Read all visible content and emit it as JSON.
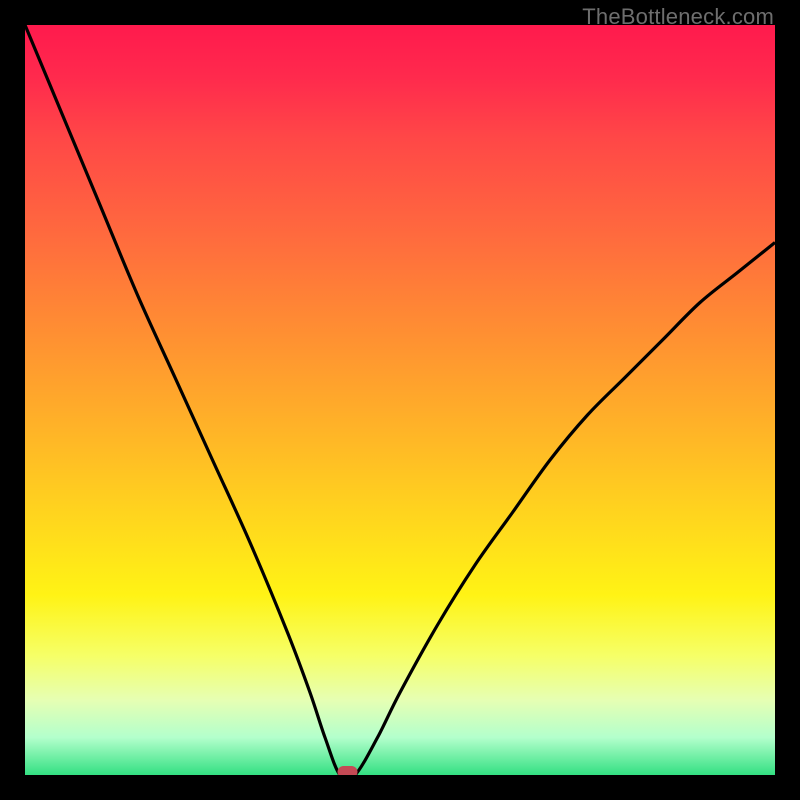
{
  "watermark": "TheBottleneck.com",
  "chart_data": {
    "type": "line",
    "title": "",
    "xlabel": "",
    "ylabel": "",
    "xlim": [
      0,
      100
    ],
    "ylim": [
      0,
      100
    ],
    "series": [
      {
        "name": "bottleneck-curve",
        "x": [
          0,
          5,
          10,
          15,
          20,
          25,
          30,
          35,
          38,
          40,
          42,
          44,
          47,
          50,
          55,
          60,
          65,
          70,
          75,
          80,
          85,
          90,
          95,
          100
        ],
        "y": [
          100,
          88,
          76,
          64,
          53,
          42,
          31,
          19,
          11,
          5,
          0,
          0,
          5,
          11,
          20,
          28,
          35,
          42,
          48,
          53,
          58,
          63,
          67,
          71
        ]
      }
    ],
    "marker": {
      "x": 43,
      "y": 0,
      "color": "#c44a55"
    },
    "gradient_stops": [
      {
        "pos": 0,
        "color": "#ff1a4d"
      },
      {
        "pos": 50,
        "color": "#ffd11f"
      },
      {
        "pos": 90,
        "color": "#e6ffb3"
      },
      {
        "pos": 100,
        "color": "#33e082"
      }
    ]
  }
}
